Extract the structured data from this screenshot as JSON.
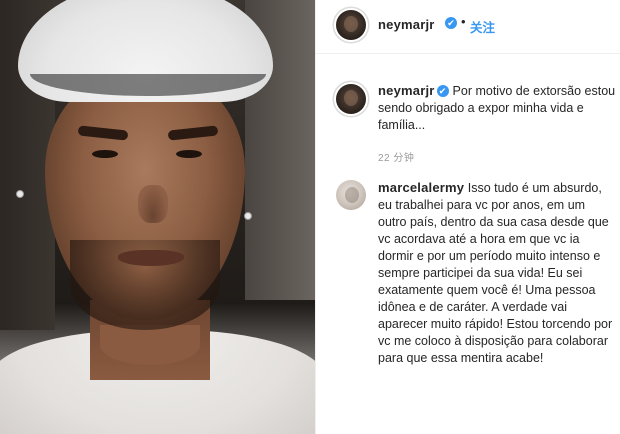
{
  "post": {
    "author": "neymarjr",
    "verified_symbol": "✔",
    "separator": "•",
    "follow_label": "关注",
    "caption": "Por motivo de extorsão estou sendo obrigado a expor minha vida e família...",
    "time_ago": "22 分钟"
  },
  "comment": {
    "author": "marcelalermy",
    "text": "Isso tudo é um absurdo, eu trabalhei para vc por anos, em um outro país, dentro da sua casa desde que vc acordava até a hora em que vc ia dormir e por um período muito intenso e sempre participei da sua vida! Eu sei exatamente quem você é! Uma pessoa idônea e de caráter. A verdade vai aparecer muito rápido! Estou torcendo por vc me coloco à disposição para colaborar para que essa mentira acabe!"
  },
  "colors": {
    "link_blue": "#3897f0",
    "text": "#262626",
    "muted": "#999999"
  }
}
